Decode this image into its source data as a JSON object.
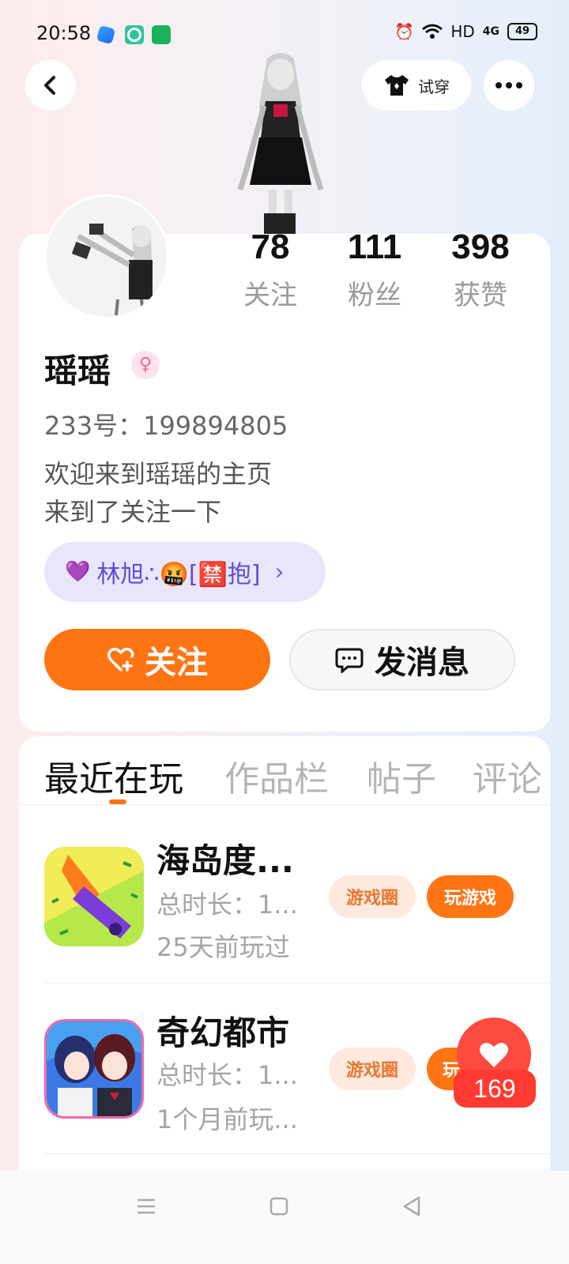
{
  "status_bar": {
    "time": "20:58",
    "network": "HD",
    "signal": "4G",
    "battery": "49",
    "icons": [
      "app-icon-blue",
      "app-icon-green-circle",
      "app-icon-green-square",
      "alarm-icon",
      "wifi-icon",
      "battery-icon"
    ]
  },
  "header": {
    "try_on_label": "试穿",
    "back_icon": "chevron-left-icon",
    "more_icon": "more-dots-icon"
  },
  "stats": [
    {
      "value": "78",
      "label": "关注"
    },
    {
      "value": "111",
      "label": "粉丝"
    },
    {
      "value": "398",
      "label": "获赞"
    }
  ],
  "profile": {
    "name": "瑶瑶",
    "gender_icon": "female-icon",
    "uid": "233号：199894805",
    "bio_line1": "欢迎来到瑶瑶的主页",
    "bio_line2": "来到了关注一下",
    "relation_tag": "林旭∴🤬[🈲抱]",
    "relation_arrow": "›"
  },
  "actions": {
    "follow_label": "关注",
    "message_label": "发消息"
  },
  "tabs": [
    {
      "label": "最近在玩",
      "active": true
    },
    {
      "label": "作品栏",
      "active": false
    },
    {
      "label": "帖子",
      "active": false
    },
    {
      "label": "评论",
      "active": false
    }
  ],
  "games": [
    {
      "title": "海岛度...",
      "duration": "总时长：1...",
      "last_played": "25天前玩过",
      "circle_label": "游戏圈",
      "play_label": "玩游戏"
    },
    {
      "title": "奇幻都市",
      "duration": "总时长：1...",
      "last_played": "1个月前玩...",
      "circle_label": "游戏圈",
      "play_label": "玩"
    }
  ],
  "like_fab": {
    "count": "169"
  },
  "colors": {
    "accent": "#ff7413",
    "like": "#ff4a40",
    "tag_bg": "#e9e6fb"
  }
}
